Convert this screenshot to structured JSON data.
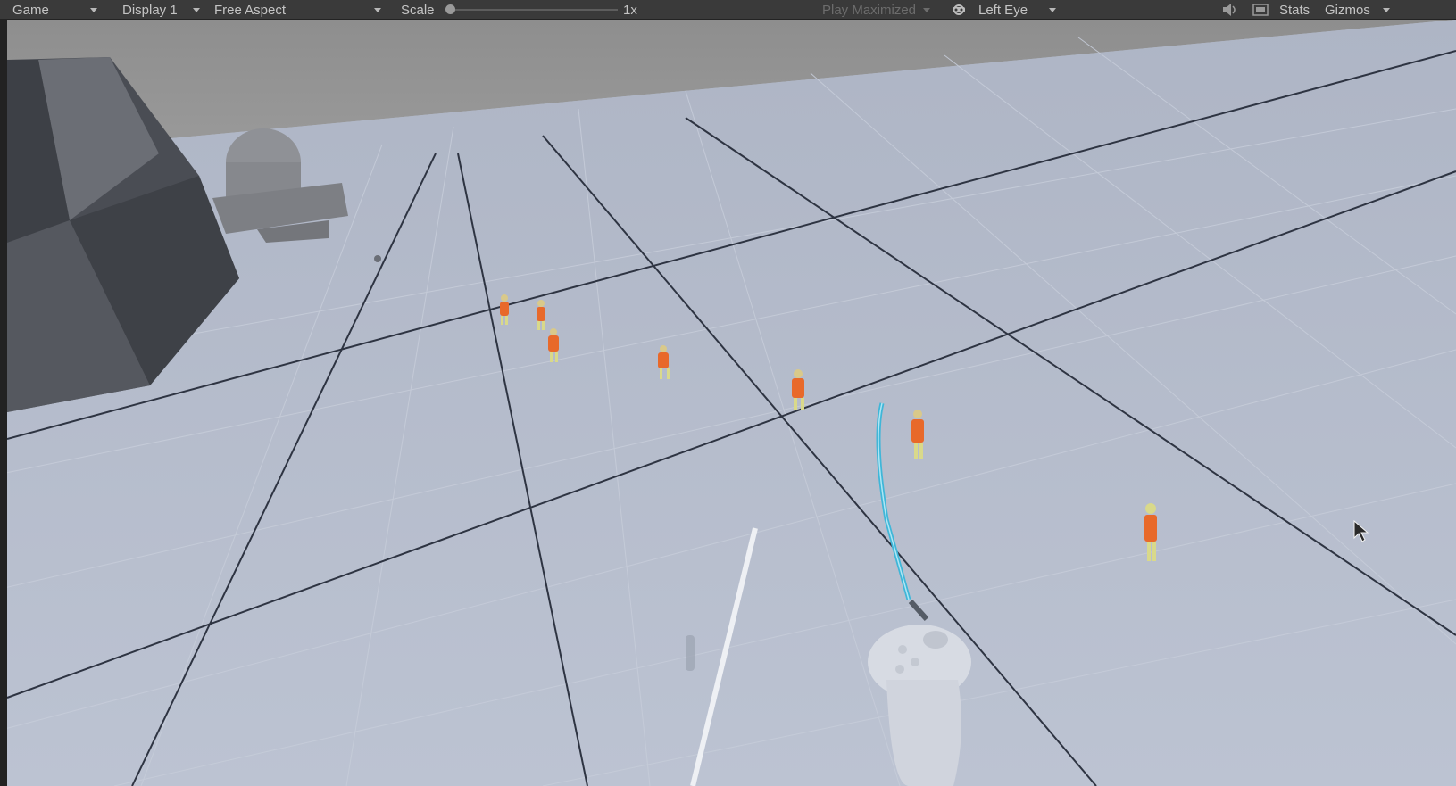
{
  "toolbar": {
    "game_label": "Game",
    "display_label": "Display 1",
    "aspect_label": "Free Aspect",
    "scale_label": "Scale",
    "scale_value": "1x",
    "play_mode_label": "Play Maximized",
    "eye_label": "Left Eye",
    "stats_label": "Stats",
    "gizmos_label": "Gizmos",
    "scale_slider_level": 0.0
  },
  "icons": {
    "dropdown": "chevron-down-icon",
    "vr": "vr-headset-icon",
    "audio": "speaker-icon",
    "aspect": "aspect-icon",
    "cursor": "mouse-cursor-icon"
  },
  "colors": {
    "floor": "#b6bdcc",
    "grid_line": "#2d3340",
    "figure_body": "#e8692a",
    "figure_skin": "#d9d98a",
    "ray": "#3fb6d8"
  }
}
